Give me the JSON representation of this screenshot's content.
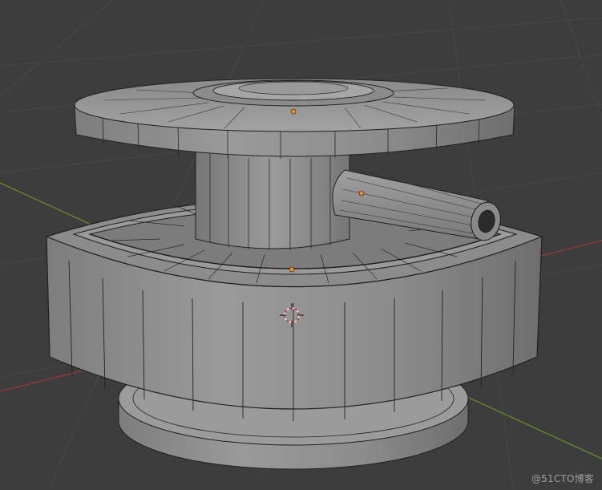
{
  "watermark": {
    "text": "@51CTO博客"
  },
  "viewport": {
    "background_color": "#3d3d3d",
    "grid_color": "#4a4a4a",
    "x_axis_color": "#9a3a3a",
    "y_axis_color": "#6a8a2a"
  },
  "mesh": {
    "surface_color": "#8f8f8f",
    "surface_light": "#a3a3a3",
    "surface_dark": "#6e6e6e",
    "edge_color": "#1f1f1f",
    "origin_point_color": "#f08a24"
  },
  "icons": [
    "3d-cursor-icon"
  ]
}
